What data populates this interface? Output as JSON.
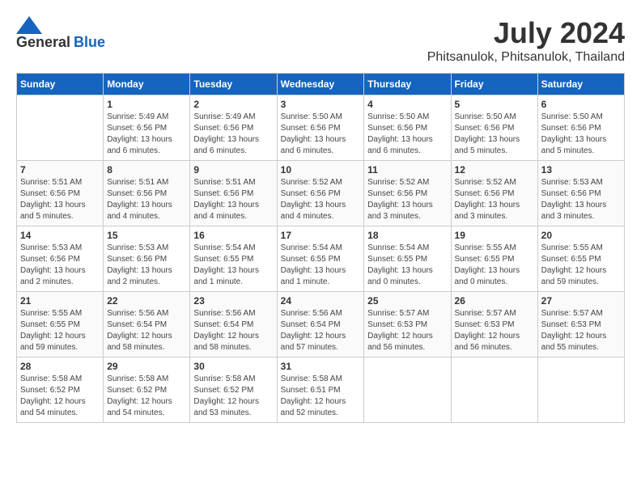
{
  "header": {
    "logo_general": "General",
    "logo_blue": "Blue",
    "month_year": "July 2024",
    "location": "Phitsanulok, Phitsanulok, Thailand"
  },
  "weekdays": [
    "Sunday",
    "Monday",
    "Tuesday",
    "Wednesday",
    "Thursday",
    "Friday",
    "Saturday"
  ],
  "weeks": [
    [
      {
        "day": "",
        "sunrise": "",
        "sunset": "",
        "daylight": ""
      },
      {
        "day": "1",
        "sunrise": "Sunrise: 5:49 AM",
        "sunset": "Sunset: 6:56 PM",
        "daylight": "Daylight: 13 hours and 6 minutes."
      },
      {
        "day": "2",
        "sunrise": "Sunrise: 5:49 AM",
        "sunset": "Sunset: 6:56 PM",
        "daylight": "Daylight: 13 hours and 6 minutes."
      },
      {
        "day": "3",
        "sunrise": "Sunrise: 5:50 AM",
        "sunset": "Sunset: 6:56 PM",
        "daylight": "Daylight: 13 hours and 6 minutes."
      },
      {
        "day": "4",
        "sunrise": "Sunrise: 5:50 AM",
        "sunset": "Sunset: 6:56 PM",
        "daylight": "Daylight: 13 hours and 6 minutes."
      },
      {
        "day": "5",
        "sunrise": "Sunrise: 5:50 AM",
        "sunset": "Sunset: 6:56 PM",
        "daylight": "Daylight: 13 hours and 5 minutes."
      },
      {
        "day": "6",
        "sunrise": "Sunrise: 5:50 AM",
        "sunset": "Sunset: 6:56 PM",
        "daylight": "Daylight: 13 hours and 5 minutes."
      }
    ],
    [
      {
        "day": "7",
        "sunrise": "Sunrise: 5:51 AM",
        "sunset": "Sunset: 6:56 PM",
        "daylight": "Daylight: 13 hours and 5 minutes."
      },
      {
        "day": "8",
        "sunrise": "Sunrise: 5:51 AM",
        "sunset": "Sunset: 6:56 PM",
        "daylight": "Daylight: 13 hours and 4 minutes."
      },
      {
        "day": "9",
        "sunrise": "Sunrise: 5:51 AM",
        "sunset": "Sunset: 6:56 PM",
        "daylight": "Daylight: 13 hours and 4 minutes."
      },
      {
        "day": "10",
        "sunrise": "Sunrise: 5:52 AM",
        "sunset": "Sunset: 6:56 PM",
        "daylight": "Daylight: 13 hours and 4 minutes."
      },
      {
        "day": "11",
        "sunrise": "Sunrise: 5:52 AM",
        "sunset": "Sunset: 6:56 PM",
        "daylight": "Daylight: 13 hours and 3 minutes."
      },
      {
        "day": "12",
        "sunrise": "Sunrise: 5:52 AM",
        "sunset": "Sunset: 6:56 PM",
        "daylight": "Daylight: 13 hours and 3 minutes."
      },
      {
        "day": "13",
        "sunrise": "Sunrise: 5:53 AM",
        "sunset": "Sunset: 6:56 PM",
        "daylight": "Daylight: 13 hours and 3 minutes."
      }
    ],
    [
      {
        "day": "14",
        "sunrise": "Sunrise: 5:53 AM",
        "sunset": "Sunset: 6:56 PM",
        "daylight": "Daylight: 13 hours and 2 minutes."
      },
      {
        "day": "15",
        "sunrise": "Sunrise: 5:53 AM",
        "sunset": "Sunset: 6:56 PM",
        "daylight": "Daylight: 13 hours and 2 minutes."
      },
      {
        "day": "16",
        "sunrise": "Sunrise: 5:54 AM",
        "sunset": "Sunset: 6:55 PM",
        "daylight": "Daylight: 13 hours and 1 minute."
      },
      {
        "day": "17",
        "sunrise": "Sunrise: 5:54 AM",
        "sunset": "Sunset: 6:55 PM",
        "daylight": "Daylight: 13 hours and 1 minute."
      },
      {
        "day": "18",
        "sunrise": "Sunrise: 5:54 AM",
        "sunset": "Sunset: 6:55 PM",
        "daylight": "Daylight: 13 hours and 0 minutes."
      },
      {
        "day": "19",
        "sunrise": "Sunrise: 5:55 AM",
        "sunset": "Sunset: 6:55 PM",
        "daylight": "Daylight: 13 hours and 0 minutes."
      },
      {
        "day": "20",
        "sunrise": "Sunrise: 5:55 AM",
        "sunset": "Sunset: 6:55 PM",
        "daylight": "Daylight: 12 hours and 59 minutes."
      }
    ],
    [
      {
        "day": "21",
        "sunrise": "Sunrise: 5:55 AM",
        "sunset": "Sunset: 6:55 PM",
        "daylight": "Daylight: 12 hours and 59 minutes."
      },
      {
        "day": "22",
        "sunrise": "Sunrise: 5:56 AM",
        "sunset": "Sunset: 6:54 PM",
        "daylight": "Daylight: 12 hours and 58 minutes."
      },
      {
        "day": "23",
        "sunrise": "Sunrise: 5:56 AM",
        "sunset": "Sunset: 6:54 PM",
        "daylight": "Daylight: 12 hours and 58 minutes."
      },
      {
        "day": "24",
        "sunrise": "Sunrise: 5:56 AM",
        "sunset": "Sunset: 6:54 PM",
        "daylight": "Daylight: 12 hours and 57 minutes."
      },
      {
        "day": "25",
        "sunrise": "Sunrise: 5:57 AM",
        "sunset": "Sunset: 6:53 PM",
        "daylight": "Daylight: 12 hours and 56 minutes."
      },
      {
        "day": "26",
        "sunrise": "Sunrise: 5:57 AM",
        "sunset": "Sunset: 6:53 PM",
        "daylight": "Daylight: 12 hours and 56 minutes."
      },
      {
        "day": "27",
        "sunrise": "Sunrise: 5:57 AM",
        "sunset": "Sunset: 6:53 PM",
        "daylight": "Daylight: 12 hours and 55 minutes."
      }
    ],
    [
      {
        "day": "28",
        "sunrise": "Sunrise: 5:58 AM",
        "sunset": "Sunset: 6:52 PM",
        "daylight": "Daylight: 12 hours and 54 minutes."
      },
      {
        "day": "29",
        "sunrise": "Sunrise: 5:58 AM",
        "sunset": "Sunset: 6:52 PM",
        "daylight": "Daylight: 12 hours and 54 minutes."
      },
      {
        "day": "30",
        "sunrise": "Sunrise: 5:58 AM",
        "sunset": "Sunset: 6:52 PM",
        "daylight": "Daylight: 12 hours and 53 minutes."
      },
      {
        "day": "31",
        "sunrise": "Sunrise: 5:58 AM",
        "sunset": "Sunset: 6:51 PM",
        "daylight": "Daylight: 12 hours and 52 minutes."
      },
      {
        "day": "",
        "sunrise": "",
        "sunset": "",
        "daylight": ""
      },
      {
        "day": "",
        "sunrise": "",
        "sunset": "",
        "daylight": ""
      },
      {
        "day": "",
        "sunrise": "",
        "sunset": "",
        "daylight": ""
      }
    ]
  ]
}
